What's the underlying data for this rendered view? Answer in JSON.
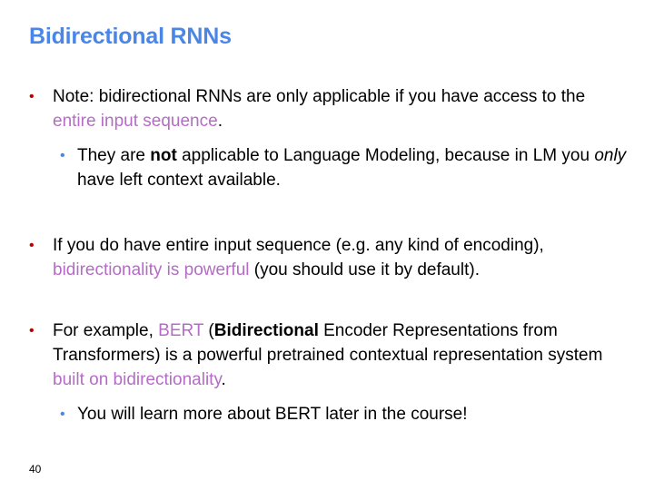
{
  "slide": {
    "title": "Bidirectional RNNs",
    "page_number": "40",
    "bullet_marker": "•",
    "bullets": [
      {
        "p1": "Note: bidirectional RNNs are only applicable if you have access to the ",
        "hl1": "entire input sequence",
        "p2": ".",
        "sub": {
          "p1": "They are ",
          "b1": "not",
          "p2": " applicable to Language Modeling, because in LM you ",
          "i1": "only",
          "p3": " have left context available."
        }
      },
      {
        "p1": "If you do have entire input sequence (e.g. any kind of encoding), ",
        "hl1": "bidirectionality is powerful",
        "p2": " (you should use it by default)."
      },
      {
        "p1": "For example, ",
        "hl1": "BERT",
        "p2": " (",
        "b1": "Bidirectional",
        "p3": " Encoder Representations from Transformers) is a powerful pretrained contextual representation system ",
        "hl2": "built on bidirectionality",
        "p4": ".",
        "sub": {
          "p1": "You will learn more about BERT later in the course!"
        }
      }
    ],
    "colors": {
      "title": "#4a86e8",
      "bullet_marker": "#c00000",
      "sub_bullet_marker": "#4a86e8",
      "highlight": "#b56cc6"
    }
  }
}
